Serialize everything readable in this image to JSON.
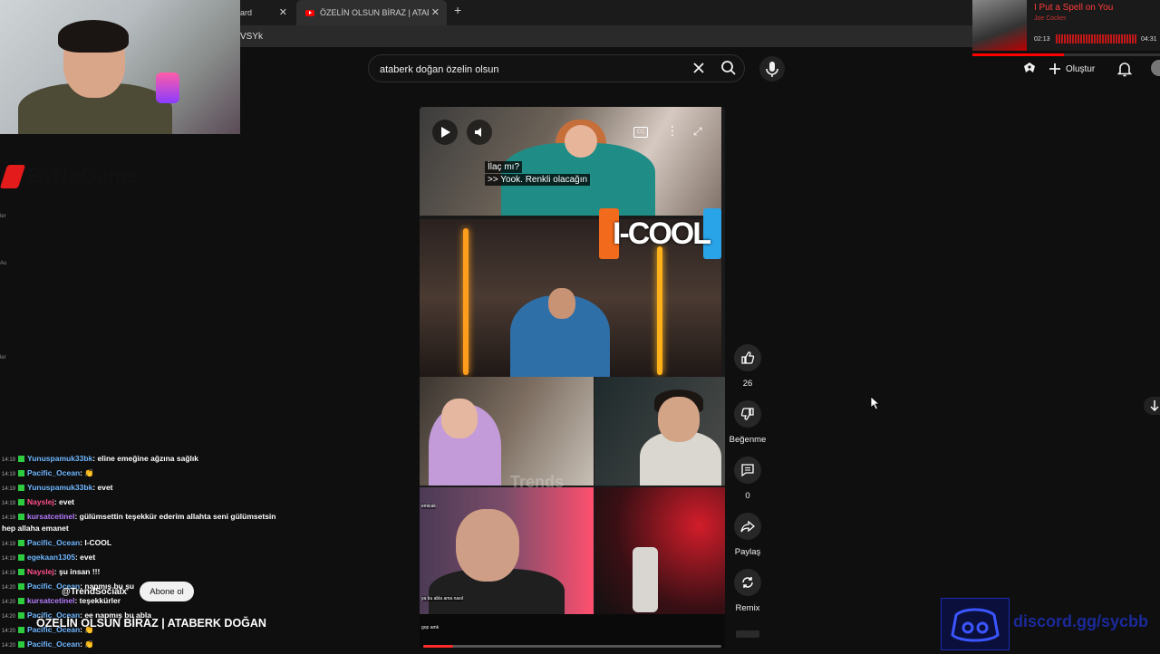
{
  "browser": {
    "tab1_label": "ard",
    "tab2_label": "ÖZELİN OLSUN BİRAZ | ATABERK",
    "new_tab": "+",
    "address_fragment": "VSYk"
  },
  "overlay": {
    "sponsor_logo": "ByNoGame",
    "side_ticks": [
      "ler",
      "Au",
      "ler"
    ]
  },
  "music_player": {
    "title": "I Put a Spell on You",
    "artist": "Joe Cocker",
    "elapsed": "02:13",
    "duration": "04:31",
    "progress": 0.49
  },
  "search": {
    "query": "ataberk doğan özelin olsun"
  },
  "header": {
    "create_label": "Oluştur"
  },
  "video": {
    "captions": [
      "İlaç mı?",
      ">> Yook. Renkli olacağın"
    ],
    "cc_label": "CC",
    "brand": "I-COOL",
    "watermark": "Trends",
    "mini_caption_1": "emicak",
    "mini_caption_2": "ya bu abla ama nasıl",
    "mini_caption_3": "gop amk",
    "progress": 0.1
  },
  "actions": {
    "like_count": "26",
    "dislike_label": "Beğenme",
    "comment_count": "0",
    "share_label": "Paylaş",
    "remix_label": "Remix"
  },
  "channel": {
    "handle": "@TrendSocialx",
    "subscribe_label": "Abone ol",
    "title": "ÖZELİN OLSUN BİRAZ | ATABERK DOĞAN"
  },
  "chat": [
    {
      "time": "14:19",
      "user": "Yunuspamuk33bk",
      "text": ": eline emeğine ağzına sağlık",
      "color": "blue"
    },
    {
      "time": "14:19",
      "user": "Pacific_Ocean",
      "text": ": 👏",
      "color": "blue"
    },
    {
      "time": "14:19",
      "user": "Yunuspamuk33bk",
      "text": ": evet",
      "color": "blue"
    },
    {
      "time": "14:19",
      "user": "Nayslej",
      "text": ": evet",
      "color": "pink"
    },
    {
      "time": "14:19",
      "user": "kursatcetinel",
      "text": ": gülümsettin teşekkür ederim allahta seni gülümsetsin",
      "color": "purple"
    },
    {
      "time": "",
      "user": "",
      "text": "hep allaha emanet",
      "color": "none"
    },
    {
      "time": "14:19",
      "user": "Pacific_Ocean",
      "text": ": I-COOL",
      "color": "blue"
    },
    {
      "time": "14:19",
      "user": "egekaan1305",
      "text": ": evet",
      "color": "blue"
    },
    {
      "time": "14:19",
      "user": "Nayslej",
      "text": ": şu insan !!!",
      "color": "pink"
    },
    {
      "time": "14:20",
      "user": "Pacific_Ocean",
      "text": ": napmış bu şu",
      "color": "blue"
    },
    {
      "time": "14:20",
      "user": "kursatcetinel",
      "text": ": teşekkürler",
      "color": "purple"
    },
    {
      "time": "14:20",
      "user": "Pacific_Ocean",
      "text": ": ee napmış bu abla",
      "color": "blue"
    },
    {
      "time": "14:20",
      "user": "Pacific_Ocean",
      "text": ": 👏",
      "color": "blue"
    },
    {
      "time": "14:20",
      "user": "Pacific_Ocean",
      "text": ": 👏",
      "color": "blue"
    }
  ],
  "discord": {
    "url": "discord.gg/sycbb"
  },
  "colors": {
    "background": "#0f0f0f",
    "accent": "#ff0000",
    "chat_user_blue": "#6eb6ff",
    "chat_user_pink": "#ff4f8b",
    "chat_user_purple": "#b47cff"
  }
}
